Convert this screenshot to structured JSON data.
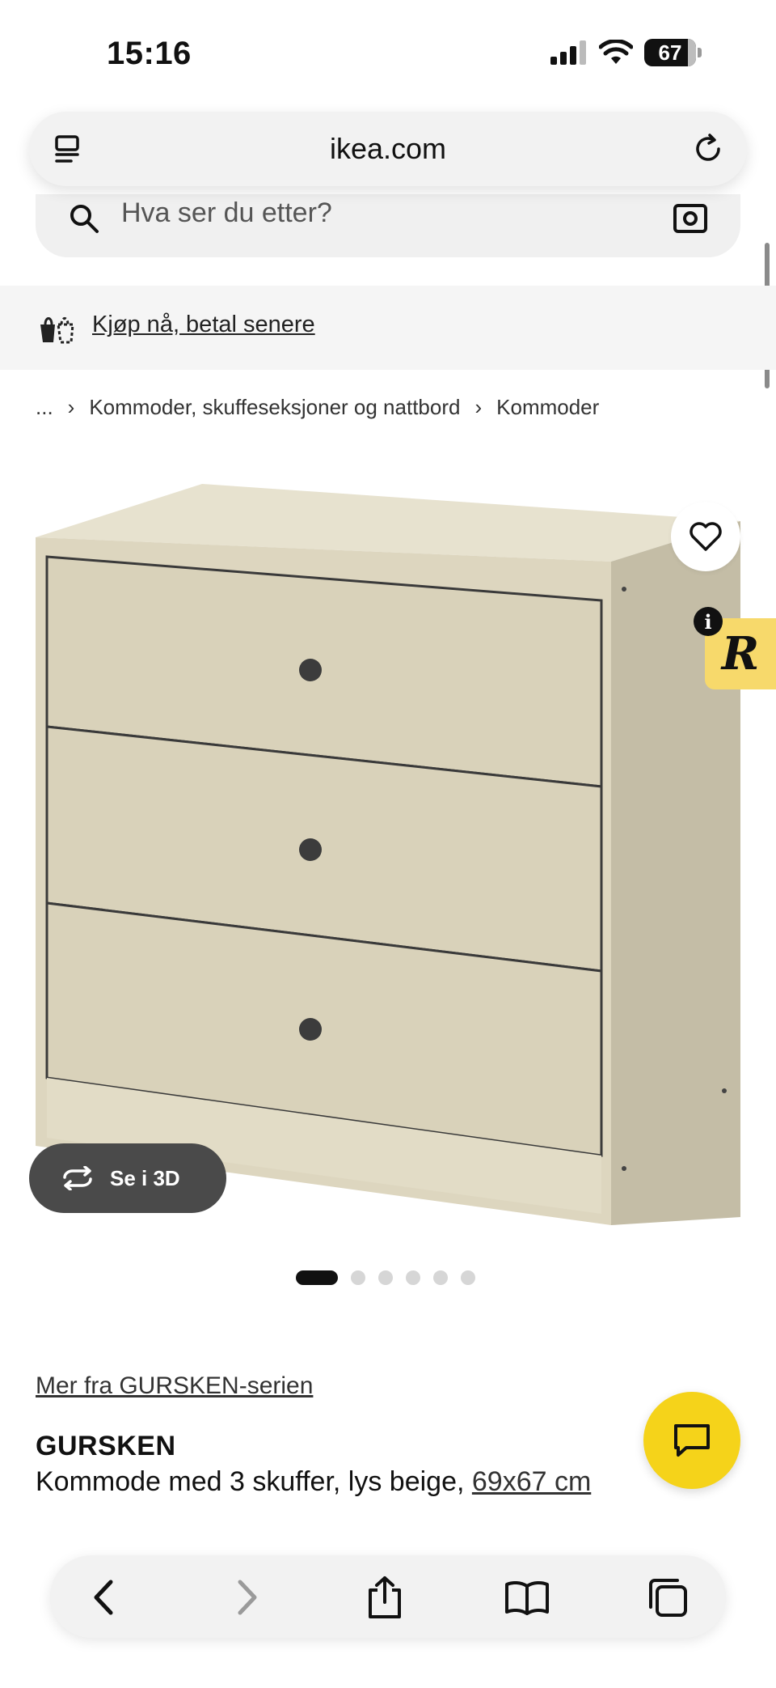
{
  "status_bar": {
    "time": "15:16",
    "battery": "67"
  },
  "browser": {
    "url": "ikea.com"
  },
  "search": {
    "placeholder": "Hva ser du etter?"
  },
  "banner": {
    "link_text": "Kjøp nå, betal senere"
  },
  "breadcrumb": {
    "ellipsis": "...",
    "items": [
      "Kommoder, skuffeseksjoner og nattbord",
      "Kommoder"
    ]
  },
  "product": {
    "view_3d_label": "Se i 3D",
    "gallery": {
      "image_count": 6,
      "active_index": 0
    },
    "series_link": "Mer fra GURSKEN-serien",
    "name": "GURSKEN",
    "description": "Kommode med 3 skuffer, lys beige,",
    "size": "69x67 cm",
    "product_color": "#dcd5bf"
  },
  "colors": {
    "chat_accent": "#f5d31a",
    "badge": "#f7d96b"
  }
}
